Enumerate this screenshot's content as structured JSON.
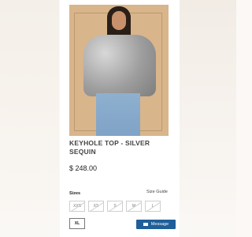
{
  "product": {
    "title": "KEYHOLE TOP - SILVER SEQUIN",
    "price": "$ 248.00"
  },
  "sizes": {
    "label": "Sizes",
    "guide_label": "Size Guide",
    "options": [
      {
        "label": "XXS",
        "available": false
      },
      {
        "label": "XS",
        "available": false
      },
      {
        "label": "S",
        "available": false
      },
      {
        "label": "M",
        "available": false
      },
      {
        "label": "L",
        "available": false
      },
      {
        "label": "XL",
        "available": true
      }
    ]
  },
  "message_button": {
    "label": "Message",
    "icon": "mail-icon"
  },
  "colors": {
    "accent": "#1f5f99",
    "background": "#ffffff"
  }
}
